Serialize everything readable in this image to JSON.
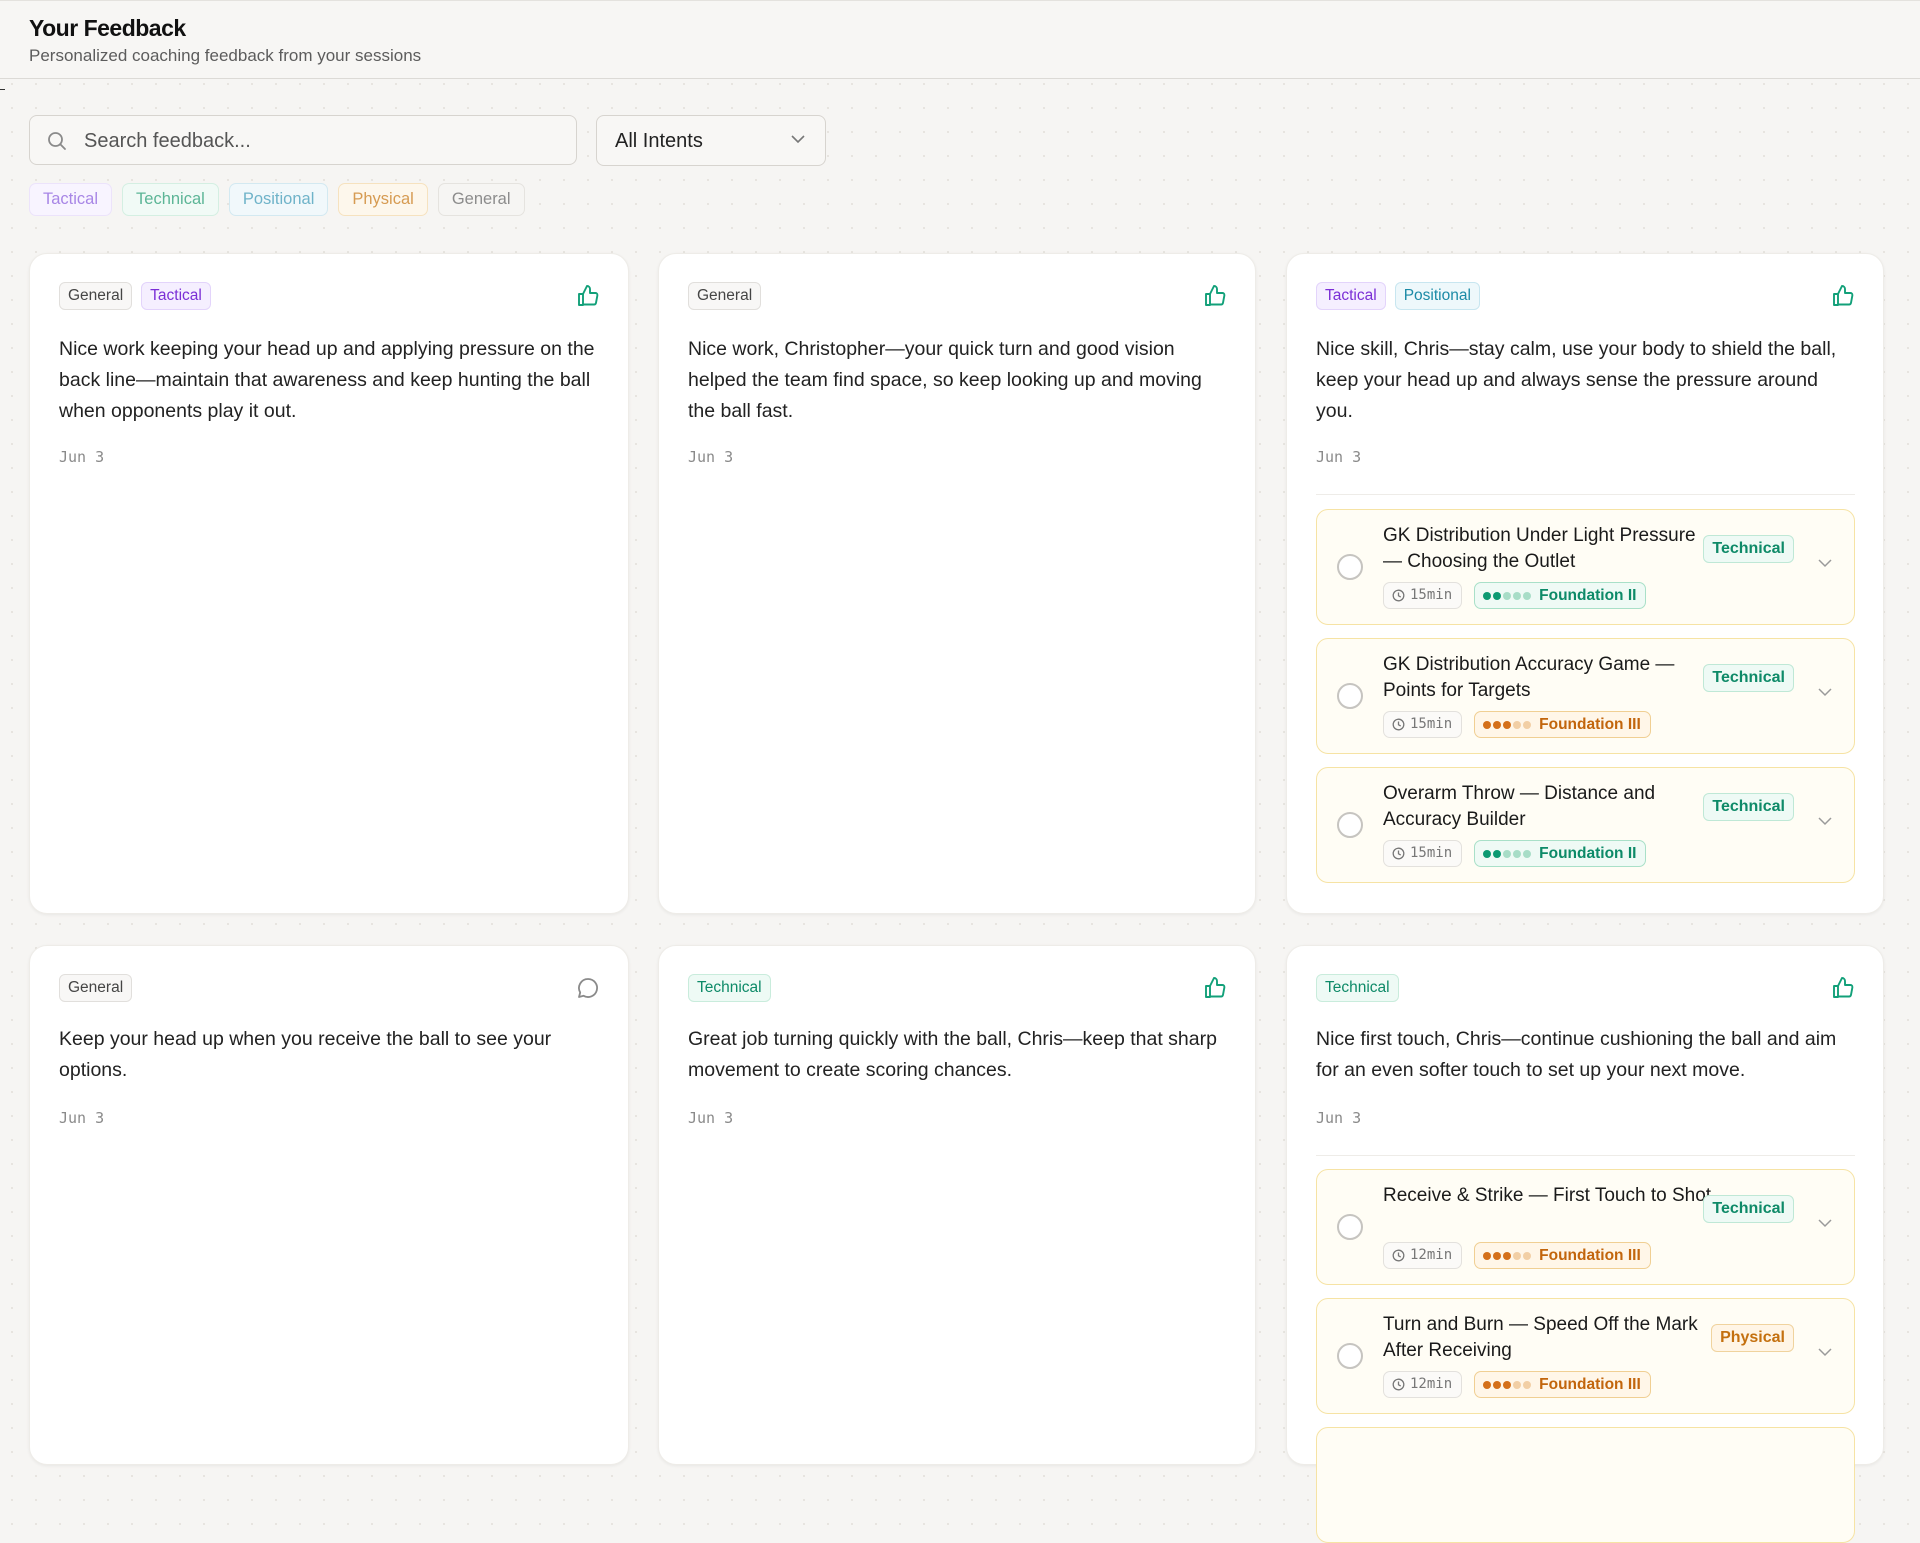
{
  "header": {
    "title": "Your Feedback",
    "subtitle": "Personalized coaching feedback from your sessions"
  },
  "search": {
    "placeholder": "Search feedback..."
  },
  "intent_filter": {
    "selected": "All Intents"
  },
  "filter_chips": [
    "Tactical",
    "Technical",
    "Positional",
    "Physical",
    "General"
  ],
  "colors": {
    "tactical": "#7b2fd6",
    "technical": "#0e8a68",
    "positional": "#1b8aa6",
    "physical": "#c4700f",
    "thumbs_up": "#12a079",
    "drill_border": "#f6e3a4"
  },
  "cards": [
    {
      "tags": [
        "General",
        "Tactical"
      ],
      "icon": "thumbs-up-icon",
      "text": "Nice work keeping your head up and applying pressure on the back line—maintain that awareness and keep hunting the ball when opponents play it out.",
      "date": "Jun 3"
    },
    {
      "tags": [
        "General"
      ],
      "icon": "thumbs-up-icon",
      "text": "Nice work, Christopher—your quick turn and good vision helped the team find space, so keep looking up and moving the ball fast.",
      "date": "Jun 3"
    },
    {
      "tags": [
        "Tactical",
        "Positional"
      ],
      "icon": "thumbs-up-icon",
      "text": "Nice skill, Chris—stay calm, use your body to shield the ball, keep your head up and always sense the pressure around you.",
      "date": "Jun 3",
      "drills": [
        {
          "title": "GK Distribution Under Light Pressure — Choosing the Outlet",
          "tag": "Technical",
          "duration": "15min",
          "level": "Foundation II",
          "level_dots": 2
        },
        {
          "title": "GK Distribution Accuracy Game — Points for Targets",
          "tag": "Technical",
          "duration": "15min",
          "level": "Foundation III",
          "level_dots": 3
        },
        {
          "title": "Overarm Throw — Distance and Accuracy Builder",
          "tag": "Technical",
          "duration": "15min",
          "level": "Foundation II",
          "level_dots": 2
        }
      ]
    },
    {
      "tags": [
        "General"
      ],
      "icon": "comment-icon",
      "text": "Keep your head up when you receive the ball to see your options.",
      "date": "Jun 3"
    },
    {
      "tags": [
        "Technical"
      ],
      "icon": "thumbs-up-icon",
      "text": "Great job turning quickly with the ball, Chris—keep that sharp movement to create scoring chances.",
      "date": "Jun 3"
    },
    {
      "tags": [
        "Technical"
      ],
      "icon": "thumbs-up-icon",
      "text": "Nice first touch, Chris—continue cushioning the ball and aim for an even softer touch to set up your next move.",
      "date": "Jun 3",
      "drills": [
        {
          "title": "Receive & Strike — First Touch to Shot",
          "tag": "Technical",
          "duration": "12min",
          "level": "Foundation III",
          "level_dots": 3
        },
        {
          "title": "Turn and Burn — Speed Off the Mark After Receiving",
          "tag": "Physical",
          "duration": "12min",
          "level": "Foundation III",
          "level_dots": 3
        }
      ]
    }
  ]
}
